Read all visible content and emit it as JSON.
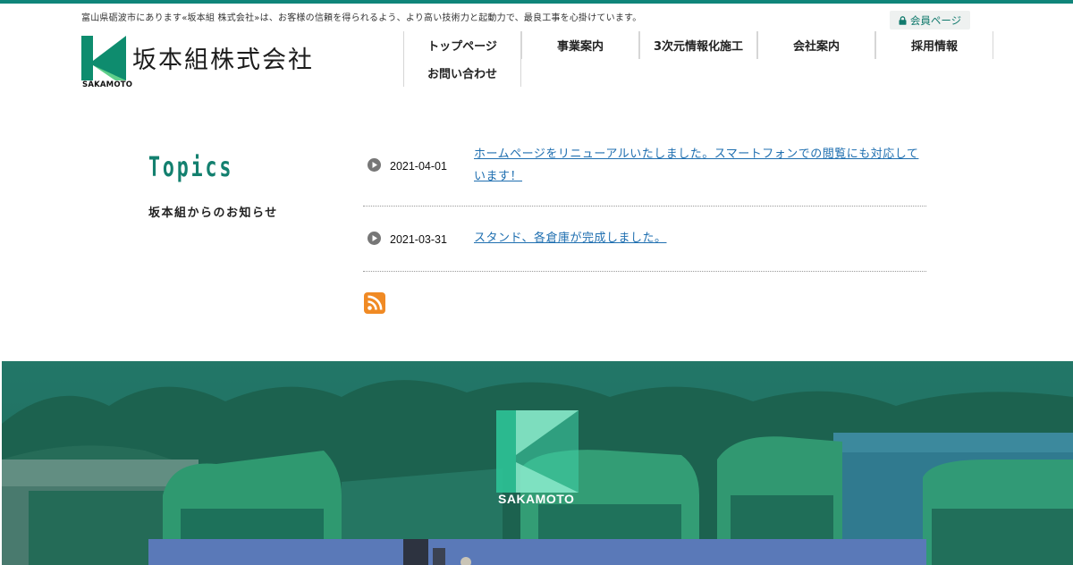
{
  "header": {
    "tagline": "富山県砺波市にあります«坂本組 株式会社»は、お客様の信頼を得られるよう、より高い技術力と起動力で、最良工事を心掛けています。",
    "member_label": "会員ページ",
    "logo_name": "坂本組株式会社",
    "logo_sub": "SAKAMOTO"
  },
  "nav": {
    "items": [
      "トップページ",
      "事業案内",
      "3次元情報化施工",
      "会社案内",
      "採用情報",
      "お問い合わせ"
    ]
  },
  "topics": {
    "title": "Topics",
    "subtitle": "坂本組からのお知らせ",
    "items": [
      {
        "date": "2021-04-01",
        "text": "ホームページをリニューアルいたしました。スマートフォンでの閲覧にも対応しています！"
      },
      {
        "date": "2021-03-31",
        "text": "スタンド、各倉庫が完成しました。"
      }
    ]
  },
  "hero": {
    "logo_text": "SAKAMOTO"
  },
  "colors": {
    "brand": "#10857a",
    "link": "#1f6fb0",
    "rss": "#f08a24"
  },
  "icons": [
    "lock-icon",
    "play-icon",
    "rss-icon"
  ]
}
